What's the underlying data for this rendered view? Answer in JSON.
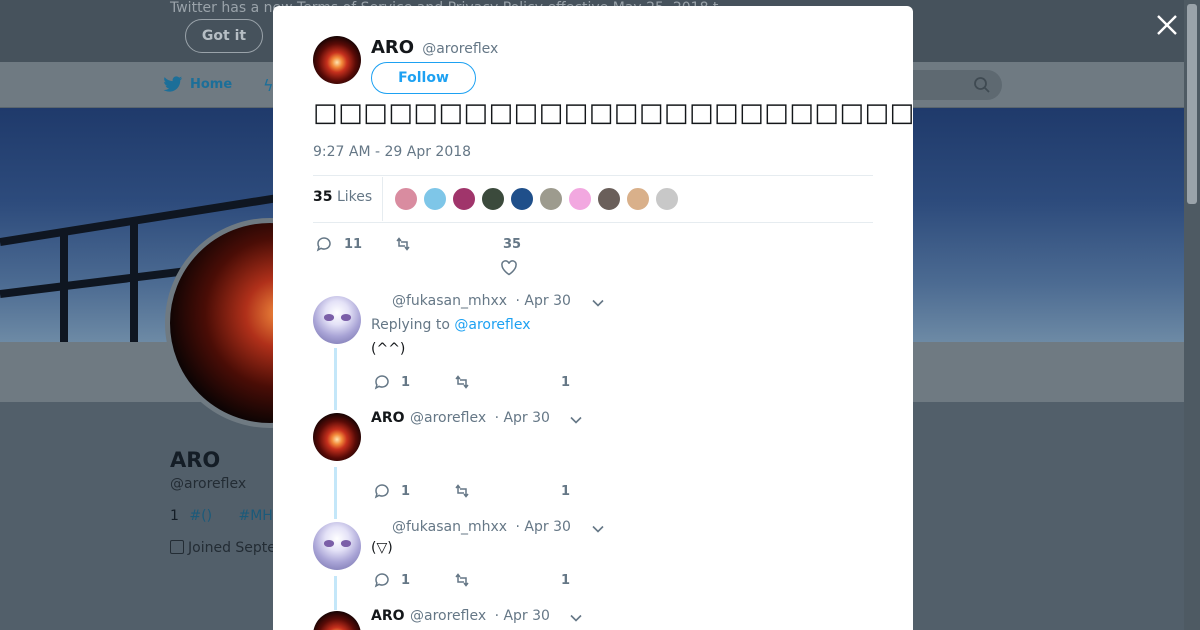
{
  "background": {
    "notice_text": "Twitter has a new Terms of Service and Privacy Policy effective May 25, 2018 t",
    "got_it_label": "Got it",
    "nav_home_label": "Home",
    "profile_name": "ARO",
    "profile_handle": "@aroreflex",
    "bio_count": "1",
    "bio_tag1": "#()",
    "bio_tag2": "#MHX",
    "joined_text": "Joined Septe"
  },
  "tweet": {
    "author_name": "ARO",
    "author_handle": "@aroreflex",
    "follow_label": "Follow",
    "text": "□□□□□□□□□□□□□□□□□□□□□□□□□□□□XX□□□□□□□□□□□□□□□□□□□",
    "timestamp": "9:27 AM - 29 Apr 2018",
    "likes_count": "35",
    "likes_label": "Likes",
    "reply_count": "11",
    "retweet_count": "",
    "like_count": "35"
  },
  "likers": [
    {
      "color": "#d98ca0"
    },
    {
      "color": "#7ec6e8"
    },
    {
      "color": "#a0356b"
    },
    {
      "color": "#3b4a3c"
    },
    {
      "color": "#1f4f8a"
    },
    {
      "color": "#9d9b8e"
    },
    {
      "color": "#f2a8e0"
    },
    {
      "color": "#6a5f5a"
    },
    {
      "color": "#d9b08a"
    },
    {
      "color": "#c8c8c8"
    }
  ],
  "replies": [
    {
      "name": "",
      "handle": "@fukasan_mhxx",
      "date": "· Apr 30",
      "replying_prefix": "Replying to",
      "replying_handle": "@aroreflex",
      "text": "(^^)",
      "reply_count": "1",
      "like_count": "1"
    },
    {
      "name": "ARO",
      "handle": "@aroreflex",
      "date": "· Apr 30",
      "text": "",
      "reply_count": "1",
      "like_count": "1"
    },
    {
      "name": "",
      "handle": "@fukasan_mhxx",
      "date": "· Apr 30",
      "text": "(▽)",
      "reply_count": "1",
      "like_count": "1"
    },
    {
      "name": "ARO",
      "handle": "@aroreflex",
      "date": "· Apr 30"
    }
  ],
  "colors": {
    "accent": "#1da1f2",
    "overlay": "#525f6a",
    "text_secondary": "#657786"
  }
}
